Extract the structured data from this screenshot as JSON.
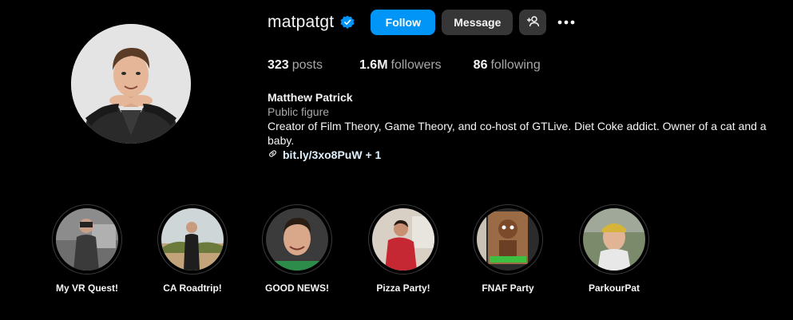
{
  "profile": {
    "username": "matpatgt",
    "verified_icon": "verified-badge-icon",
    "full_name": "Matthew Patrick",
    "category": "Public figure",
    "bio_line1": "Creator of Film Theory, Game Theory, and co-host of GTLive. Diet Coke addict. Owner of a cat and a",
    "bio_line2": "baby.",
    "link_text": "bit.ly/3xo8PuW + 1",
    "link_icon": "link-icon"
  },
  "actions": {
    "follow_label": "Follow",
    "message_label": "Message",
    "suggest_icon": "add-person-icon",
    "more_icon": "more-options-icon"
  },
  "stats": {
    "posts_count": "323",
    "posts_label": "posts",
    "followers_count": "1.6M",
    "followers_label": "followers",
    "following_count": "86",
    "following_label": "following"
  },
  "highlights": [
    {
      "label": "My VR Quest!"
    },
    {
      "label": "CA Roadtrip!"
    },
    {
      "label": "GOOD NEWS!"
    },
    {
      "label": "Pizza Party!"
    },
    {
      "label": "FNAF Party"
    },
    {
      "label": "ParkourPat"
    }
  ],
  "colors": {
    "background": "#000000",
    "follow_button": "#0095f6",
    "secondary_button": "#363636",
    "verified": "#0095f6",
    "muted_text": "#a8a8a8"
  }
}
